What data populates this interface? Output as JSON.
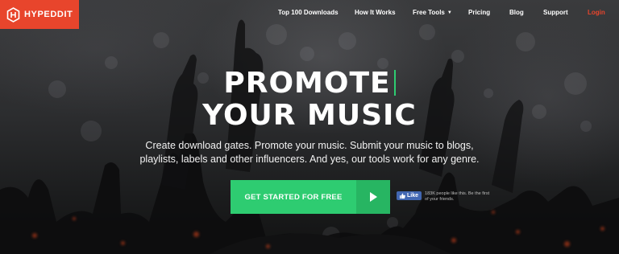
{
  "brand": {
    "name": "HYPEDDIT",
    "accent_color": "#e8452c",
    "logo_icon": "hexagon-h-icon"
  },
  "nav": {
    "items": [
      {
        "label": "Top 100 Downloads"
      },
      {
        "label": "How It Works"
      },
      {
        "label": "Free Tools",
        "icon": "caret-down-icon"
      },
      {
        "label": "Pricing"
      },
      {
        "label": "Blog"
      },
      {
        "label": "Support"
      },
      {
        "label": "Login",
        "color": "#e8452c"
      }
    ]
  },
  "hero": {
    "headline_line1": "PROMOTE",
    "headline_line2": "YOUR MUSIC",
    "cursor_color": "#2ecc71",
    "subtitle_line1": "Create download gates. Promote your music. Submit your music to blogs,",
    "subtitle_line2": "playlists, labels and other influencers. And yes, our tools work for any genre."
  },
  "cta": {
    "label": "GET STARTED FOR FREE",
    "icon": "play-icon",
    "color": "#2ecc71"
  },
  "facebook": {
    "button_label": "Like",
    "icon": "thumbs-up-icon",
    "count_text_line1": "183K people like this. Be the first",
    "count_text_line2": "of your friends."
  }
}
